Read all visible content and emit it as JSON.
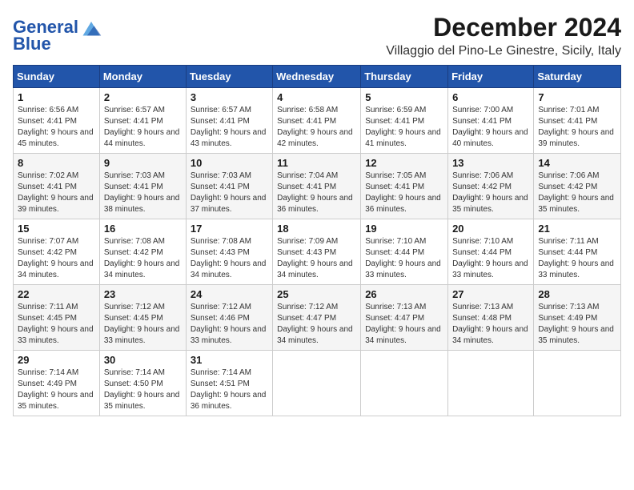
{
  "logo": {
    "text_general": "General",
    "text_blue": "Blue",
    "icon_color": "#4499dd"
  },
  "title": "December 2024",
  "subtitle": "Villaggio del Pino-Le Ginestre, Sicily, Italy",
  "colors": {
    "header_bg": "#2255aa",
    "header_text": "#ffffff",
    "row_odd": "#ffffff",
    "row_even": "#f5f5f5"
  },
  "weekdays": [
    "Sunday",
    "Monday",
    "Tuesday",
    "Wednesday",
    "Thursday",
    "Friday",
    "Saturday"
  ],
  "weeks": [
    [
      {
        "day": "1",
        "sunrise": "Sunrise: 6:56 AM",
        "sunset": "Sunset: 4:41 PM",
        "daylight": "Daylight: 9 hours and 45 minutes."
      },
      {
        "day": "2",
        "sunrise": "Sunrise: 6:57 AM",
        "sunset": "Sunset: 4:41 PM",
        "daylight": "Daylight: 9 hours and 44 minutes."
      },
      {
        "day": "3",
        "sunrise": "Sunrise: 6:57 AM",
        "sunset": "Sunset: 4:41 PM",
        "daylight": "Daylight: 9 hours and 43 minutes."
      },
      {
        "day": "4",
        "sunrise": "Sunrise: 6:58 AM",
        "sunset": "Sunset: 4:41 PM",
        "daylight": "Daylight: 9 hours and 42 minutes."
      },
      {
        "day": "5",
        "sunrise": "Sunrise: 6:59 AM",
        "sunset": "Sunset: 4:41 PM",
        "daylight": "Daylight: 9 hours and 41 minutes."
      },
      {
        "day": "6",
        "sunrise": "Sunrise: 7:00 AM",
        "sunset": "Sunset: 4:41 PM",
        "daylight": "Daylight: 9 hours and 40 minutes."
      },
      {
        "day": "7",
        "sunrise": "Sunrise: 7:01 AM",
        "sunset": "Sunset: 4:41 PM",
        "daylight": "Daylight: 9 hours and 39 minutes."
      }
    ],
    [
      {
        "day": "8",
        "sunrise": "Sunrise: 7:02 AM",
        "sunset": "Sunset: 4:41 PM",
        "daylight": "Daylight: 9 hours and 39 minutes."
      },
      {
        "day": "9",
        "sunrise": "Sunrise: 7:03 AM",
        "sunset": "Sunset: 4:41 PM",
        "daylight": "Daylight: 9 hours and 38 minutes."
      },
      {
        "day": "10",
        "sunrise": "Sunrise: 7:03 AM",
        "sunset": "Sunset: 4:41 PM",
        "daylight": "Daylight: 9 hours and 37 minutes."
      },
      {
        "day": "11",
        "sunrise": "Sunrise: 7:04 AM",
        "sunset": "Sunset: 4:41 PM",
        "daylight": "Daylight: 9 hours and 36 minutes."
      },
      {
        "day": "12",
        "sunrise": "Sunrise: 7:05 AM",
        "sunset": "Sunset: 4:41 PM",
        "daylight": "Daylight: 9 hours and 36 minutes."
      },
      {
        "day": "13",
        "sunrise": "Sunrise: 7:06 AM",
        "sunset": "Sunset: 4:42 PM",
        "daylight": "Daylight: 9 hours and 35 minutes."
      },
      {
        "day": "14",
        "sunrise": "Sunrise: 7:06 AM",
        "sunset": "Sunset: 4:42 PM",
        "daylight": "Daylight: 9 hours and 35 minutes."
      }
    ],
    [
      {
        "day": "15",
        "sunrise": "Sunrise: 7:07 AM",
        "sunset": "Sunset: 4:42 PM",
        "daylight": "Daylight: 9 hours and 34 minutes."
      },
      {
        "day": "16",
        "sunrise": "Sunrise: 7:08 AM",
        "sunset": "Sunset: 4:42 PM",
        "daylight": "Daylight: 9 hours and 34 minutes."
      },
      {
        "day": "17",
        "sunrise": "Sunrise: 7:08 AM",
        "sunset": "Sunset: 4:43 PM",
        "daylight": "Daylight: 9 hours and 34 minutes."
      },
      {
        "day": "18",
        "sunrise": "Sunrise: 7:09 AM",
        "sunset": "Sunset: 4:43 PM",
        "daylight": "Daylight: 9 hours and 34 minutes."
      },
      {
        "day": "19",
        "sunrise": "Sunrise: 7:10 AM",
        "sunset": "Sunset: 4:44 PM",
        "daylight": "Daylight: 9 hours and 33 minutes."
      },
      {
        "day": "20",
        "sunrise": "Sunrise: 7:10 AM",
        "sunset": "Sunset: 4:44 PM",
        "daylight": "Daylight: 9 hours and 33 minutes."
      },
      {
        "day": "21",
        "sunrise": "Sunrise: 7:11 AM",
        "sunset": "Sunset: 4:44 PM",
        "daylight": "Daylight: 9 hours and 33 minutes."
      }
    ],
    [
      {
        "day": "22",
        "sunrise": "Sunrise: 7:11 AM",
        "sunset": "Sunset: 4:45 PM",
        "daylight": "Daylight: 9 hours and 33 minutes."
      },
      {
        "day": "23",
        "sunrise": "Sunrise: 7:12 AM",
        "sunset": "Sunset: 4:45 PM",
        "daylight": "Daylight: 9 hours and 33 minutes."
      },
      {
        "day": "24",
        "sunrise": "Sunrise: 7:12 AM",
        "sunset": "Sunset: 4:46 PM",
        "daylight": "Daylight: 9 hours and 33 minutes."
      },
      {
        "day": "25",
        "sunrise": "Sunrise: 7:12 AM",
        "sunset": "Sunset: 4:47 PM",
        "daylight": "Daylight: 9 hours and 34 minutes."
      },
      {
        "day": "26",
        "sunrise": "Sunrise: 7:13 AM",
        "sunset": "Sunset: 4:47 PM",
        "daylight": "Daylight: 9 hours and 34 minutes."
      },
      {
        "day": "27",
        "sunrise": "Sunrise: 7:13 AM",
        "sunset": "Sunset: 4:48 PM",
        "daylight": "Daylight: 9 hours and 34 minutes."
      },
      {
        "day": "28",
        "sunrise": "Sunrise: 7:13 AM",
        "sunset": "Sunset: 4:49 PM",
        "daylight": "Daylight: 9 hours and 35 minutes."
      }
    ],
    [
      {
        "day": "29",
        "sunrise": "Sunrise: 7:14 AM",
        "sunset": "Sunset: 4:49 PM",
        "daylight": "Daylight: 9 hours and 35 minutes."
      },
      {
        "day": "30",
        "sunrise": "Sunrise: 7:14 AM",
        "sunset": "Sunset: 4:50 PM",
        "daylight": "Daylight: 9 hours and 35 minutes."
      },
      {
        "day": "31",
        "sunrise": "Sunrise: 7:14 AM",
        "sunset": "Sunset: 4:51 PM",
        "daylight": "Daylight: 9 hours and 36 minutes."
      },
      null,
      null,
      null,
      null
    ]
  ]
}
